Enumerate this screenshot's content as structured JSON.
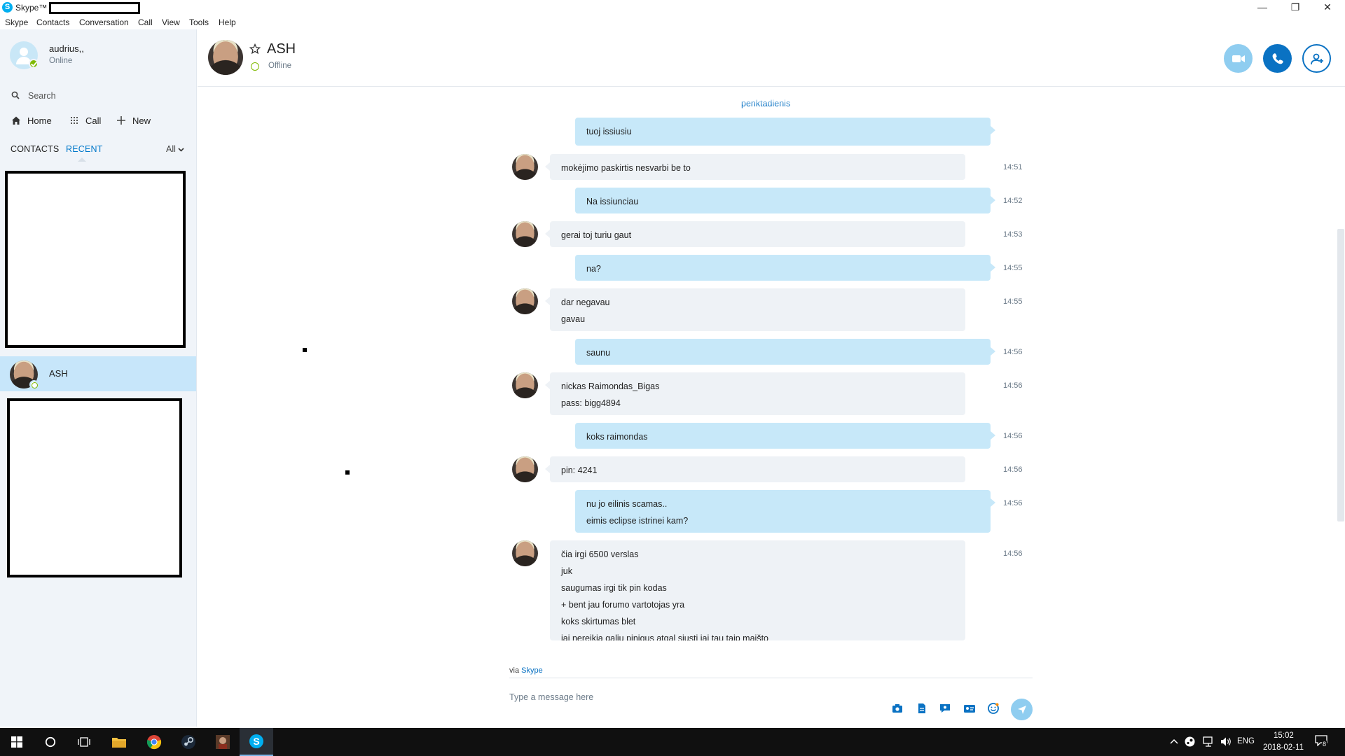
{
  "window": {
    "title": "Skype™ -",
    "minimize": "—",
    "restore": "❐",
    "close": "✕"
  },
  "menu": [
    "Skype",
    "Contacts",
    "Conversation",
    "Call",
    "View",
    "Tools",
    "Help"
  ],
  "profile": {
    "name": "audrius,,",
    "status": "Online"
  },
  "search": {
    "placeholder": "Search"
  },
  "nav": {
    "home": "Home",
    "call": "Call",
    "new": "New"
  },
  "tabs": {
    "contacts": "CONTACTS",
    "recent": "RECENT",
    "filter": "All"
  },
  "contacts": [
    {
      "name": "ASH",
      "status": "offline",
      "selected": true
    }
  ],
  "conversation": {
    "name": "ASH",
    "status": "Offline",
    "day_label": "penktadienis",
    "messages": [
      {
        "dir": "out",
        "lines": [
          "tuoj issiusiu"
        ],
        "time": ""
      },
      {
        "dir": "in",
        "lines": [
          "mokėjimo paskirtis nesvarbi be to"
        ],
        "time": "14:51"
      },
      {
        "dir": "out",
        "lines": [
          "Na issiunciau"
        ],
        "time": "14:52"
      },
      {
        "dir": "in",
        "lines": [
          "gerai toj turiu gaut"
        ],
        "time": "14:53"
      },
      {
        "dir": "out",
        "lines": [
          "na?"
        ],
        "time": "14:55"
      },
      {
        "dir": "in",
        "lines": [
          "dar negavau",
          "gavau"
        ],
        "time": "14:55"
      },
      {
        "dir": "out",
        "lines": [
          "saunu"
        ],
        "time": "14:56"
      },
      {
        "dir": "in",
        "lines": [
          "nickas Raimondas_Bigas",
          "pass: bigg4894"
        ],
        "time": "14:56"
      },
      {
        "dir": "out",
        "lines": [
          "koks raimondas"
        ],
        "time": "14:56"
      },
      {
        "dir": "in",
        "lines": [
          "pin: 4241"
        ],
        "time": "14:56"
      },
      {
        "dir": "out",
        "lines": [
          "nu jo eilinis scamas..",
          "eimis eclipse istrinei kam?"
        ],
        "time": "14:56"
      },
      {
        "dir": "in",
        "lines": [
          "čia irgi 6500 verslas",
          "juk",
          "saugumas irgi tik pin kodas",
          "+ bent jau forumo vartotojas yra",
          "koks skirtumas blet",
          "jai nereikia galiu pinigus atgal siusti jai tau taip maišto"
        ],
        "time": "14:56"
      }
    ]
  },
  "composer": {
    "via_prefix": "via",
    "via_link": "Skype",
    "placeholder": "Type a message here"
  },
  "taskbar": {
    "language": "ENG",
    "time": "15:02",
    "date": "2018-02-11",
    "notification_count": "8"
  },
  "colors": {
    "accent": "#0a72c3",
    "bubble_out": "#c7e8f9",
    "bubble_in": "#eef2f6",
    "sidebar": "#f0f4f9",
    "online": "#7fba00"
  }
}
